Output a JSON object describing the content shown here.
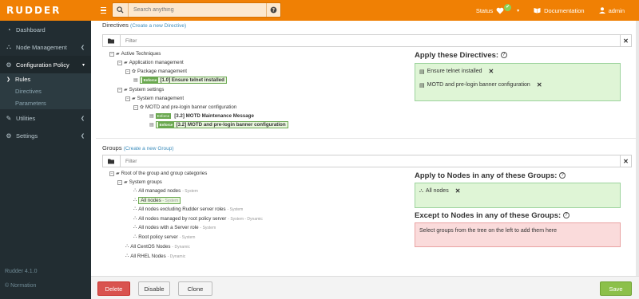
{
  "app": {
    "logo": "RUDDER"
  },
  "search": {
    "placeholder": "Search anything"
  },
  "topbar": {
    "status_label": "Status",
    "documentation_label": "Documentation",
    "user_label": "admin"
  },
  "sidebar": {
    "items": [
      {
        "label": "Dashboard",
        "icon": "dashboard-icon"
      },
      {
        "label": "Node Management",
        "icon": "sitemap-icon"
      },
      {
        "label": "Configuration Policy",
        "icon": "gears-icon"
      },
      {
        "label": "Utilities",
        "icon": "wrench-icon"
      },
      {
        "label": "Settings",
        "icon": "gear-icon"
      }
    ],
    "sub_items": [
      {
        "label": "Rules"
      },
      {
        "label": "Directives"
      },
      {
        "label": "Parameters"
      }
    ],
    "version": "Rudder 4.1.0",
    "copyright": "© Normation"
  },
  "directives": {
    "title": "Directives",
    "create_link": "(Create a new Directive)",
    "filter_placeholder": "Filter",
    "tree": {
      "root": "Active Techniques",
      "app_mgmt": "Application management",
      "pkg_mgmt": "Package management",
      "telnet_tag": "Enforce",
      "telnet_label": "[1.0] Ensure telnet installed",
      "sys_settings": "System settings",
      "sys_mgmt": "System management",
      "motd_cat": "MOTD and pre-login banner configuration",
      "motd_msg_tag": "Enforce",
      "motd_msg_label": "[3.2] MOTD Maintenance Message",
      "motd_cfg_tag": "Enforce",
      "motd_cfg_label": "[3.2] MOTD and pre-login banner configuration"
    },
    "apply_title": "Apply these Directives:",
    "applied": [
      {
        "label": "Ensure telnet installed"
      },
      {
        "label": "MOTD and pre-login banner configuration"
      }
    ]
  },
  "groups": {
    "title": "Groups",
    "create_link": "(Create a new Group)",
    "filter_placeholder": "Filter",
    "tree": {
      "root": "Root of the group and group categories",
      "sys_groups": "System groups",
      "items": [
        {
          "label": "All managed nodes",
          "sub": "- System"
        },
        {
          "label": "All nodes",
          "sub": "- System"
        },
        {
          "label": "All nodes excluding Rudder server roles",
          "sub": "- System"
        },
        {
          "label": "All nodes managed by root policy server",
          "sub": "- System - Dynamic"
        },
        {
          "label": "All nodes with a Server role",
          "sub": "- System"
        },
        {
          "label": "Root policy server",
          "sub": "- System"
        }
      ],
      "centos": {
        "label": "All CentOS Nodes",
        "sub": "- Dynamic"
      },
      "rhel": {
        "label": "All RHEL Nodes",
        "sub": "- Dynamic"
      }
    },
    "apply_title": "Apply to Nodes in any of these Groups:",
    "applied": [
      {
        "label": "All nodes"
      }
    ],
    "except_title": "Except to Nodes in any of these Groups:",
    "except_hint": "Select groups from the tree on the left to add them here"
  },
  "actions": {
    "delete": "Delete",
    "disable": "Disable",
    "clone": "Clone",
    "save": "Save"
  },
  "colors": {
    "brand": "#f08004",
    "sidebar": "#222d32",
    "enforce": "#6aa84f",
    "apply_bg": "#dff5d6",
    "except_bg": "#fadbdb",
    "delete": "#d9534f",
    "save": "#8cc04a"
  }
}
